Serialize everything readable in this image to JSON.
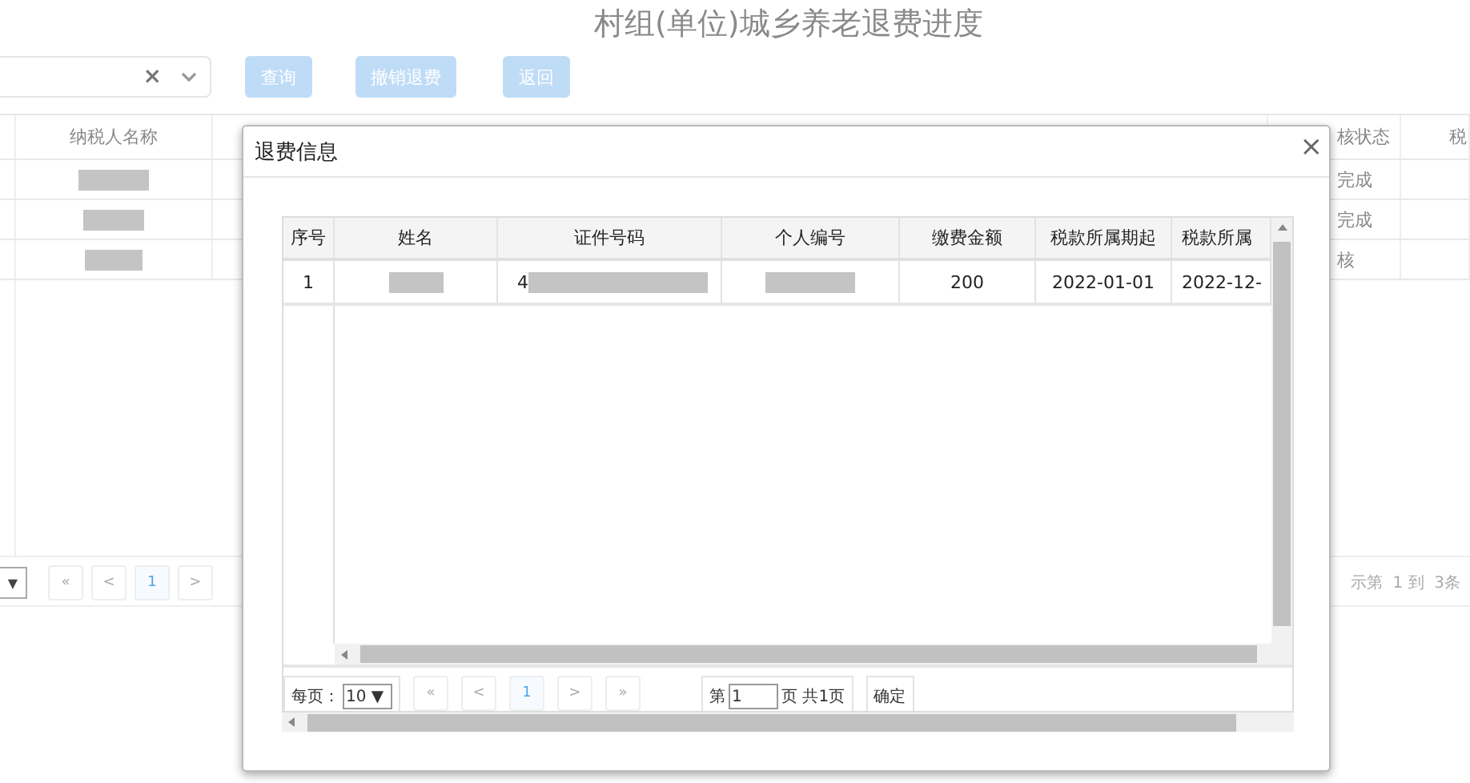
{
  "page": {
    "title": "村组(单位)城乡养老退费进度",
    "filter": {
      "clear": "×"
    },
    "buttons": [
      "查询",
      "撤销退费",
      "返回"
    ]
  },
  "background_table": {
    "columns": [
      {
        "label": "纳税人名称",
        "kind": "name"
      },
      {
        "label": "核状态",
        "kind": "status"
      },
      {
        "label": "税",
        "kind": "edge"
      }
    ],
    "rows": [
      {
        "status": "完成"
      },
      {
        "status": "完成"
      },
      {
        "status": "核"
      }
    ]
  },
  "background_pager": {
    "size_arrow": "▼",
    "nav": [
      {
        "label": "«",
        "selected": false
      },
      {
        "label": "<",
        "selected": false
      },
      {
        "label": "1",
        "selected": true
      },
      {
        "label": ">",
        "selected": false
      }
    ],
    "info": "示第  1 到  3条"
  },
  "dialog": {
    "title": "退费信息",
    "close": "×",
    "columns": [
      "序号",
      "姓名",
      "证件号码",
      "个人编号",
      "缴费金额",
      "税款所属期起",
      "税款所属"
    ],
    "rows": [
      {
        "index": "1",
        "id_number": "4",
        "amount": "200",
        "period_start": "2022-01-01",
        "period_end": "2022-12-"
      }
    ],
    "pager": {
      "page_size_label": "每页：",
      "page_size": "10",
      "size_arrow": "▼",
      "nav": [
        {
          "label": "«",
          "selected": false
        },
        {
          "label": "<",
          "selected": false
        },
        {
          "label": "1",
          "selected": true
        },
        {
          "label": ">",
          "selected": false
        },
        {
          "label": "»",
          "selected": false
        }
      ],
      "page_prefix": "第",
      "page_input": "1",
      "page_suffix": "页",
      "total": "共1页",
      "confirm": "确定"
    }
  }
}
